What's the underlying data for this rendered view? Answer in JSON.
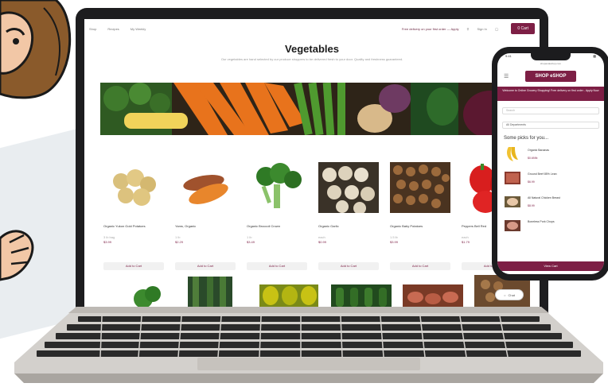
{
  "site": {
    "nav": [
      "Shop",
      "Recipes",
      "My Weekly"
    ],
    "promo": "Free delivery on your first order — Apply",
    "account": "Sign In",
    "cart_label": "0 Cart"
  },
  "page": {
    "title": "Vegetables",
    "subtitle": "Our vegetables are hand selected by our produce shoppers to be delivered fresh to your door. Quality and freshness guaranteed."
  },
  "products": [
    {
      "name": "Organic Yukon Gold Potatoes",
      "meta": "3 lb bag",
      "price": "$3.99",
      "add_label": "Add to Cart"
    },
    {
      "name": "Yams, Organic",
      "meta": "1 lb",
      "price": "$2.29",
      "add_label": "Add to Cart"
    },
    {
      "name": "Organic Broccoli Crown",
      "meta": "1 lb",
      "price": "$3.49",
      "add_label": "Add to Cart"
    },
    {
      "name": "Organic Garlic",
      "meta": "each",
      "price": "$0.99",
      "add_label": "Add to Cart"
    },
    {
      "name": "Organic Baby Potatoes",
      "meta": "1.5 lb",
      "price": "$3.99",
      "add_label": "Add to Cart"
    },
    {
      "name": "Peppers Bell Red",
      "meta": "each",
      "price": "$1.79",
      "add_label": "Add to Cart"
    }
  ],
  "chat_label": "Chat",
  "phone": {
    "time": "9:41",
    "url": "shopandeshop.com",
    "logo": "SHOP eSHOP",
    "promo": "Welcome to Online Grocery Shopping! Free delivery on first order - Apply Now",
    "search_placeholder": "Search",
    "department": "All Departments",
    "heading": "Some picks for you...",
    "items": [
      {
        "title": "Organic Bananas",
        "price": "$0.69/lb"
      },
      {
        "title": "Ground Beef 85% Lean",
        "price": "$6.99"
      },
      {
        "title": "All Natural Chicken Breast",
        "price": "$8.99"
      },
      {
        "title": "Boneless Pork Chops",
        "price": ""
      }
    ],
    "view_cart": "View Cart"
  },
  "colors": {
    "brand": "#7d1f45",
    "laptop": "#1d1d1f"
  }
}
